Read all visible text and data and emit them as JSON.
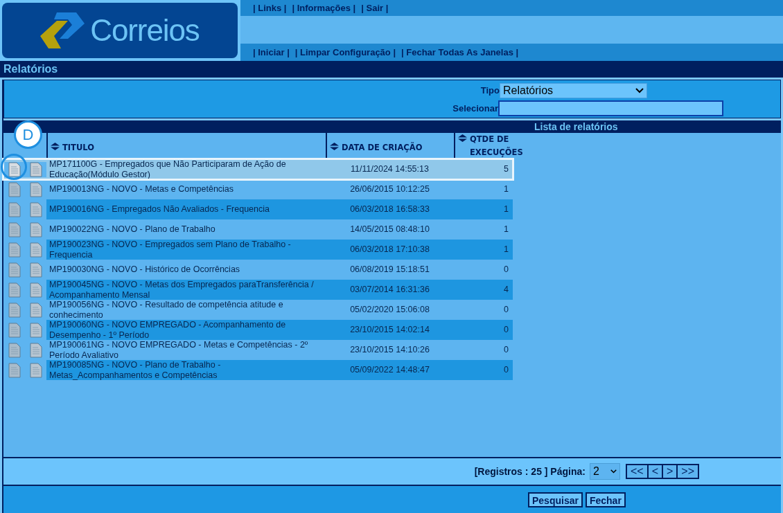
{
  "header": {
    "logo_text": "Correios",
    "top_links": [
      "| Links |",
      "| Informações |",
      "| Sair |"
    ],
    "bottom_links": [
      "| Iniciar |",
      "| Limpar Configuração |",
      "| Fechar Todas As Janelas |"
    ]
  },
  "page_title": "Relatórios",
  "filters": {
    "tipo": {
      "label": "Tipo",
      "value": "Relatórios"
    },
    "selecionar": {
      "label": "Selecionar"
    }
  },
  "list_title": "Lista de relatórios",
  "columns": [
    "TITULO",
    "DATA DE CRIAÇÃO",
    "QTDE DE EXECUÇÕES"
  ],
  "rows": [
    {
      "title": "MP171100G - Empregados que Não Participaram de Ação de Educação(Módulo Gestor)",
      "date": "11/11/2024 14:55:13",
      "count": "5",
      "selected": true
    },
    {
      "title": "MP190013NG - NOVO - Metas e Competências",
      "date": "26/06/2015 10:12:25",
      "count": "1",
      "selected": false
    },
    {
      "title": "MP190016NG - Empregados Não Avaliados - Frequencia",
      "date": "06/03/2018 16:58:33",
      "count": "1",
      "selected": false
    },
    {
      "title": "MP190022NG - NOVO - Plano de Trabalho",
      "date": "14/05/2015 08:48:10",
      "count": "1",
      "selected": false
    },
    {
      "title": "MP190023NG - NOVO - Empregados sem Plano de Trabalho - Frequencia",
      "date": "06/03/2018 17:10:38",
      "count": "1",
      "selected": false
    },
    {
      "title": "MP190030NG - NOVO - Histórico de Ocorrências",
      "date": "06/08/2019 15:18:51",
      "count": "0",
      "selected": false
    },
    {
      "title": "MP190045NG - NOVO - Metas dos Empregados paraTransferência / Acompanhamento Mensal",
      "date": "03/07/2014 16:31:36",
      "count": "4",
      "selected": false
    },
    {
      "title": "MP190056NG - NOVO - Resultado de competência atitude e conhecimento",
      "date": "05/02/2020 15:06:08",
      "count": "0",
      "selected": false
    },
    {
      "title": "MP190060NG - NOVO EMPREGADO - Acompanhamento de Desempenho - 1º Período",
      "date": "23/10/2015 14:02:14",
      "count": "0",
      "selected": false
    },
    {
      "title": "MP190061NG - NOVO EMPREGADO - Metas e Competências - 2º Período Avaliativo",
      "date": "23/10/2015 14:10:26",
      "count": "0",
      "selected": false
    },
    {
      "title": "MP190085NG - NOVO - Plano de Trabalho - Metas_Acompanhamentos e Competências",
      "date": "05/09/2022 14:48:47",
      "count": "0",
      "selected": false
    }
  ],
  "pagination": {
    "summary": "[Registros : 25 ] Página:",
    "page": "2",
    "buttons": [
      "<<",
      "<",
      ">",
      ">>"
    ]
  },
  "actions": [
    "Pesquisar",
    "Fechar"
  ],
  "annotation": {
    "label": "D"
  }
}
